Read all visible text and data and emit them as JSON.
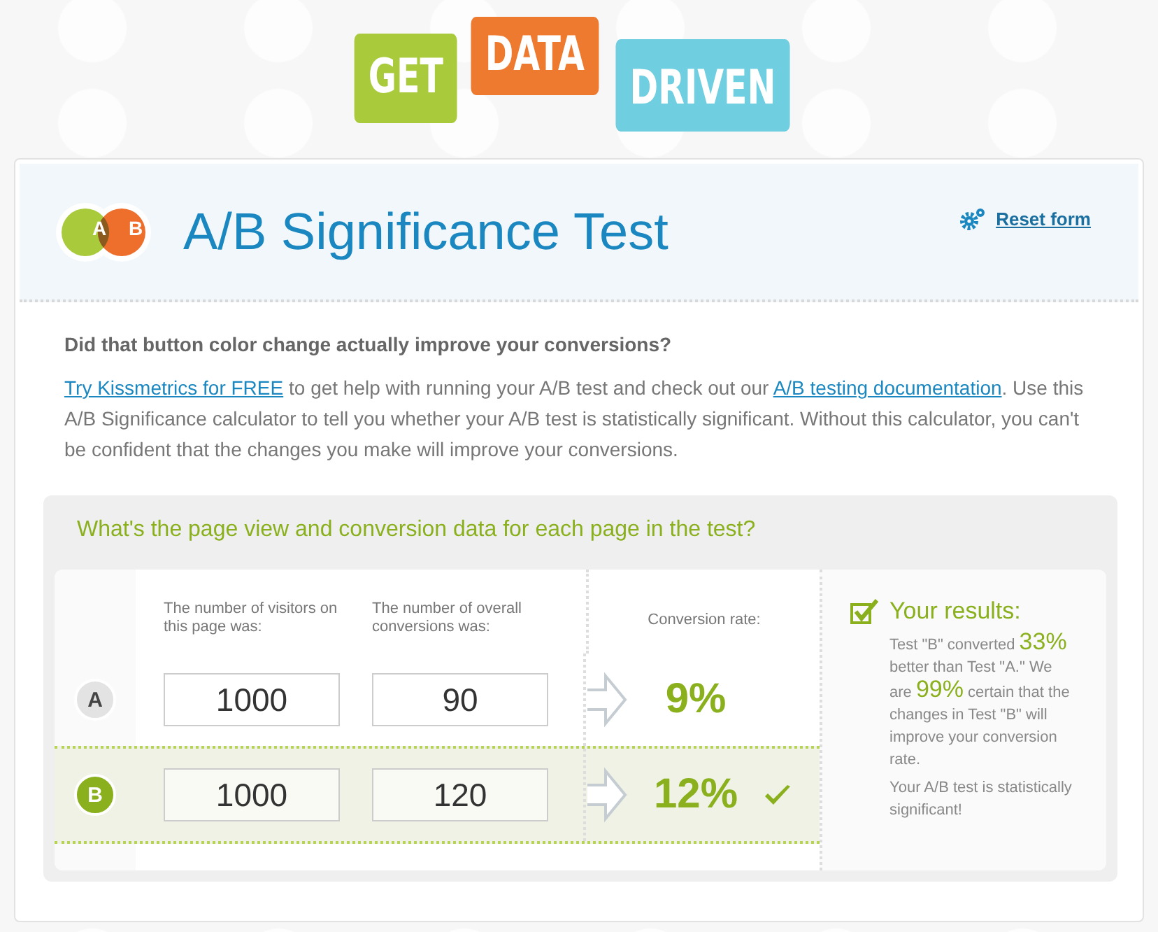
{
  "logo": {
    "words": [
      {
        "text": "GET",
        "color": "#a9cb3b"
      },
      {
        "text": "DATA",
        "color": "#ee7a30"
      },
      {
        "text": "DRIVEN",
        "color": "#6fcedf"
      }
    ]
  },
  "header": {
    "badge_letters": [
      "A",
      "B"
    ],
    "title": "A/B Significance Test",
    "reset_link": "Reset form"
  },
  "intro": {
    "question": "Did that button color change actually improve your conversions?",
    "paragraph": [
      {
        "text": "Try Kissmetrics for FREE",
        "kind": "link"
      },
      {
        "text": " to get help with running your A/B test and check out our ",
        "kind": "plain"
      },
      {
        "text": "A/B testing documentation",
        "kind": "link"
      },
      {
        "text": ". Use this A/B Significance calculator to tell you whether your A/B test is statistically significant. Without this calculator, you can't be confident that the changes you make will improve your conversions.",
        "kind": "plain"
      }
    ]
  },
  "data_panel": {
    "heading": "What's the page view and conversion data for each page in the test?",
    "columns": [
      "The number of visitors on this page was:",
      "The number of overall conversions was:",
      "Conversion rate:"
    ],
    "rows": [
      {
        "label": "A",
        "visitors": "1000",
        "conversions": "90",
        "rate": "9%",
        "winner": false
      },
      {
        "label": "B",
        "visitors": "1000",
        "conversions": "120",
        "rate": "12%",
        "winner": true
      }
    ]
  },
  "results": {
    "checked": true,
    "title": "Your results:",
    "sentence": [
      {
        "text": "Test \"B\" converted ",
        "kind": "plain"
      },
      {
        "text": "33%",
        "kind": "highlight"
      },
      {
        "text": " better than Test \"A.\" We are ",
        "kind": "plain"
      },
      {
        "text": "99%",
        "kind": "highlight"
      },
      {
        "text": " certain that the changes in Test \"B\" will improve your conversion rate.",
        "kind": "plain"
      }
    ],
    "verdict": "Your A/B test is statistically significant!"
  }
}
